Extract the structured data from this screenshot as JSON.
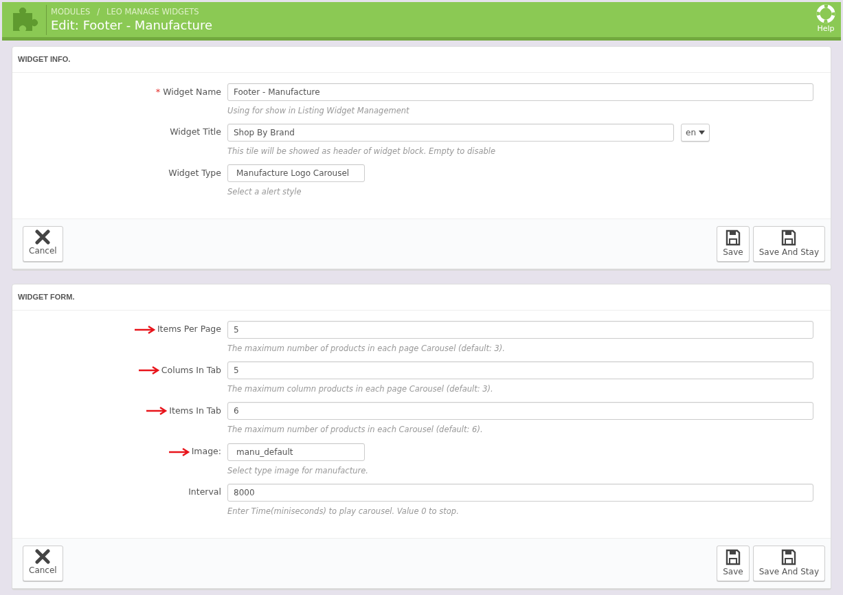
{
  "header": {
    "breadcrumb": [
      "MODULES",
      "LEO MANAGE WIDGETS"
    ],
    "title": "Edit: Footer - Manufacture",
    "help": "Help",
    "separator": "/"
  },
  "required_symbol": "*",
  "panels": [
    {
      "title": "WIDGET INFO.",
      "fields": [
        {
          "kind": "text",
          "label": "Widget Name",
          "required": true,
          "marked": false,
          "value": "Footer - Manufacture",
          "help": "Using for show in Listing Widget Management"
        },
        {
          "kind": "lang",
          "label": "Widget Title",
          "required": false,
          "marked": false,
          "value": "Shop By Brand",
          "language": "en",
          "help": "This tile will be showed as header of widget block. Empty to disable"
        },
        {
          "kind": "short",
          "label": "Widget Type",
          "required": false,
          "marked": false,
          "value": "Manufacture Logo Carousel",
          "help": "Select a alert style"
        }
      ],
      "buttons": [
        {
          "kind": "cancel",
          "label": "Cancel"
        },
        {
          "kind": "save",
          "label": "Save"
        },
        {
          "kind": "save",
          "label": "Save And Stay"
        }
      ]
    },
    {
      "title": "WIDGET FORM.",
      "fields": [
        {
          "kind": "text",
          "label": "Items Per Page",
          "required": false,
          "marked": true,
          "value": "5",
          "help": "The maximum number of products in each page Carousel (default: 3)."
        },
        {
          "kind": "text",
          "label": "Colums In Tab",
          "required": false,
          "marked": true,
          "value": "5",
          "help": "The maximum column products in each page Carousel (default: 3)."
        },
        {
          "kind": "text",
          "label": "Items In Tab",
          "required": false,
          "marked": true,
          "value": "6",
          "help": "The maximum number of products in each Carousel (default: 6)."
        },
        {
          "kind": "short",
          "label": "Image:",
          "required": false,
          "marked": true,
          "value": "manu_default",
          "help": "Select type image for manufacture."
        },
        {
          "kind": "text",
          "label": "Interval",
          "required": false,
          "marked": false,
          "value": "8000",
          "help": "Enter Time(miniseconds) to play carousel. Value 0 to stop."
        }
      ],
      "buttons": [
        {
          "kind": "cancel",
          "label": "Cancel"
        },
        {
          "kind": "save",
          "label": "Save"
        },
        {
          "kind": "save",
          "label": "Save And Stay"
        }
      ]
    }
  ]
}
